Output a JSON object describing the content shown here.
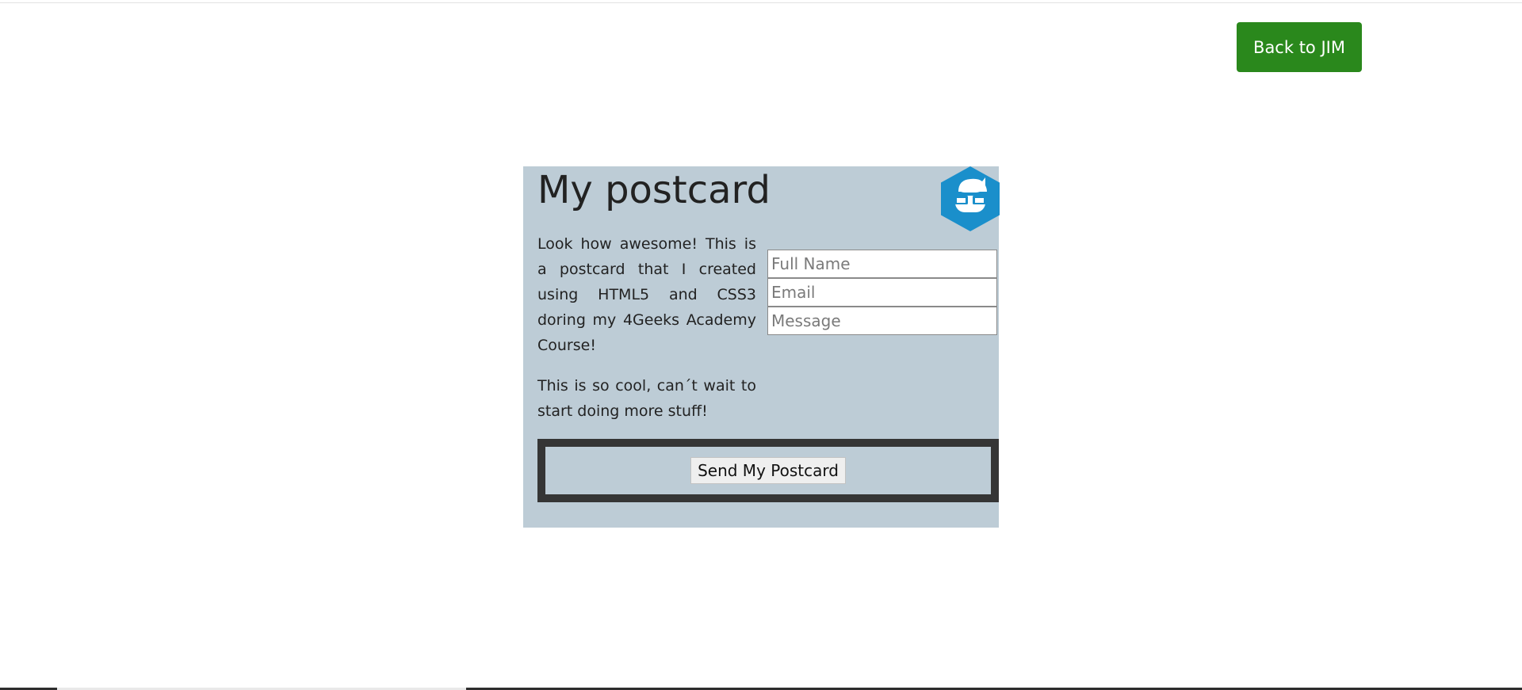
{
  "header": {
    "back_button_label": "Back to JIM"
  },
  "postcard": {
    "title": "My postcard",
    "logo_icon": "geek-hexagon-icon",
    "paragraphs": [
      "Look how awesome! This is a postcard that I created using HTML5 and CSS3 doring my 4Geeks Academy Course!",
      "This is so cool, can´t wait to start doing more stuff!"
    ],
    "form": {
      "full_name_placeholder": "Full Name",
      "email_placeholder": "Email",
      "message_placeholder": "Message",
      "send_button_label": "Send My Postcard"
    }
  },
  "colors": {
    "back_button": "#2a881c",
    "postcard_background": "#bdccd6",
    "logo": "#1a8fcb",
    "send_border": "#353535"
  }
}
